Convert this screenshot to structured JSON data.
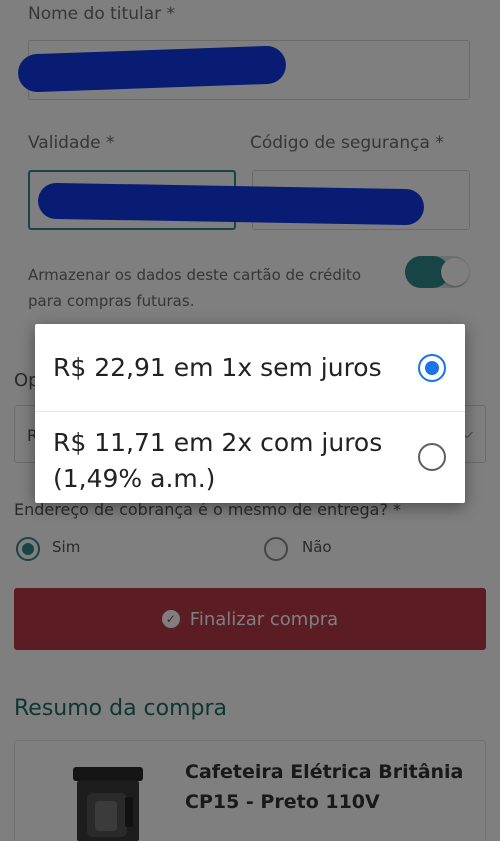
{
  "card_form": {
    "holder_label": "Nome do titular *",
    "expiry_label": "Validade *",
    "cvv_label": "Código de segurança *",
    "store_card_text": "Armazenar os dados deste cartão de crédito para compras futuras.",
    "store_card_on": true
  },
  "installments": {
    "label_partial": "Op",
    "select_partial": "R",
    "options": [
      {
        "text": "R$ 22,91 em 1x sem juros",
        "selected": true
      },
      {
        "text": "R$ 11,71 em 2x com juros (1,49% a.m.)",
        "selected": false
      }
    ]
  },
  "billing": {
    "question": "Endereço de cobrança é o mesmo de entrega? *",
    "yes": "Sim",
    "no": "Não",
    "selected": "Sim"
  },
  "checkout_button": "Finalizar compra",
  "summary": {
    "title": "Resumo da compra",
    "product_name": "Cafeteira Elétrica Britânia CP15 - Preto 110V"
  },
  "colors": {
    "accent_teal": "#2f8a8a",
    "checkout_red": "#b63947",
    "dialog_radio_blue": "#1a73e8",
    "redaction_blue": "#1038e6"
  }
}
